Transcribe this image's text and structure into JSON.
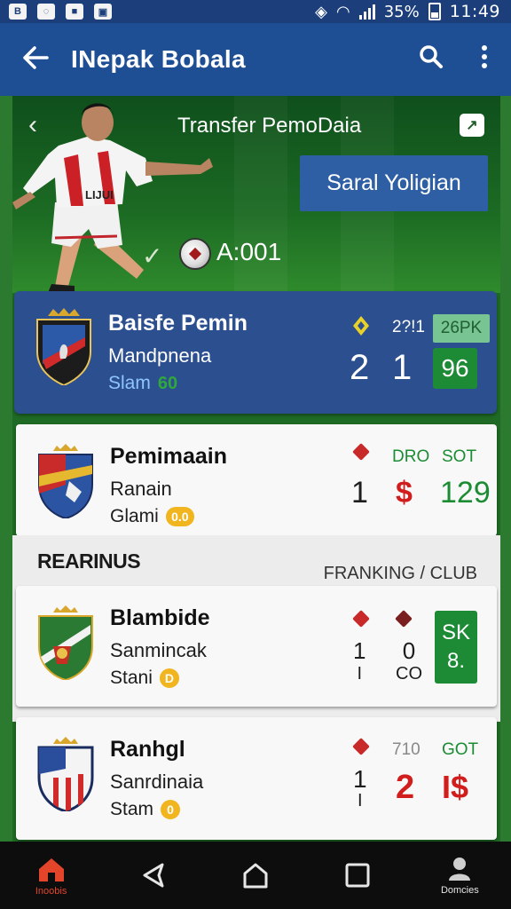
{
  "status_bar": {
    "battery": "35%",
    "time": "11:49"
  },
  "app_bar": {
    "title": "INepak Bobala"
  },
  "hero": {
    "title": "Transfer PemoDaia",
    "cta_label": "Saral Yoligian",
    "score_label": "A:001"
  },
  "cards": [
    {
      "name": "Baisfe Pemin",
      "sub": "Mandpnena",
      "sub2": "Slam",
      "badge": "60",
      "col1_hdr": "",
      "col2_hdr": "2?!1",
      "col3_hdr": "26PK",
      "col1_val": "2",
      "col2_val": "1",
      "col3_val": "96"
    },
    {
      "name": "Pemimaain",
      "sub": "Ranain",
      "sub2": "Glami",
      "badge": "0.0",
      "col2_hdr": "DRO",
      "col3_hdr": "SOT",
      "col1_val": "1",
      "col2_val": "$",
      "col3_val": "129"
    },
    {
      "name": "Blambide",
      "sub": "Sanmincak",
      "sub2": "Stani",
      "badge": "D",
      "col1_val": "1",
      "col1_val2": "I",
      "col2_val": "0",
      "col2_val2": "CO",
      "col3_val": "SK",
      "col3_val2": "8."
    },
    {
      "name": "Ranhgl",
      "sub": "Sanrdinaia",
      "sub2": "Stam",
      "badge": "0",
      "col2_hdr": "710",
      "col3_hdr": "GOT",
      "col1_val": "1",
      "col1_val2": "I",
      "col2_val": "2",
      "col3_val": "I$"
    }
  ],
  "section": {
    "title": "REARINUS",
    "right_label": "FRANKING / CLUB"
  },
  "nav": {
    "home_label": "Inoobis",
    "profile_label": "Domcies"
  },
  "colors": {
    "app_bar": "#1e4e93",
    "featured_card": "#2c4f8f",
    "accent_green": "#1d8a36",
    "accent_red": "#d21d1d"
  },
  "icons": [
    "back-arrow-icon",
    "search-icon",
    "more-vert-icon",
    "chevron-left-icon",
    "share-icon",
    "ball-icon",
    "home-icon",
    "back-nav-icon",
    "house-outline-icon",
    "square-icon",
    "profile-icon"
  ]
}
